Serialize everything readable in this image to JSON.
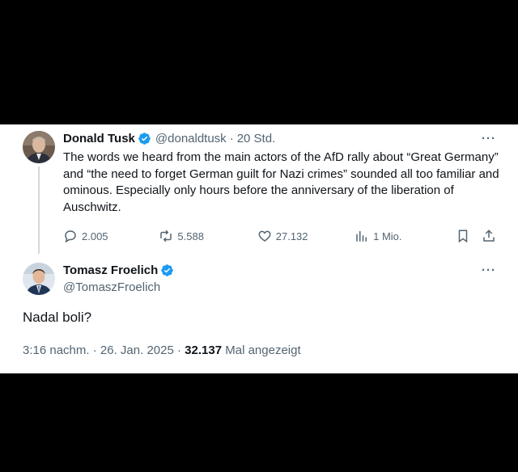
{
  "parent_tweet": {
    "author_name": "Donald Tusk",
    "handle": "@donaldtusk",
    "separator": "·",
    "time": "20 Std.",
    "more": "···",
    "text": "The words we heard from the main actors of the AfD rally about “Great Germany” and “the need to forget German guilt for Nazi crimes” sounded all too familiar and ominous. Especially only hours before the anniversary of the liberation of Auschwitz.",
    "replies": "2.005",
    "reposts": "5.588",
    "likes": "27.132",
    "views": "1 Mio."
  },
  "reply_tweet": {
    "author_name": "Tomasz Froelich",
    "handle": "@TomaszFroelich",
    "more": "···",
    "text": "Nadal boli?",
    "time": "3:16 nachm.",
    "date": "26. Jan. 2025",
    "views_count": "32.137",
    "views_label": "Mal angezeigt"
  },
  "colors": {
    "verified": "#1d9bf0",
    "muted": "#536471",
    "text": "#0f1419",
    "thread_line": "#cfd9de"
  }
}
